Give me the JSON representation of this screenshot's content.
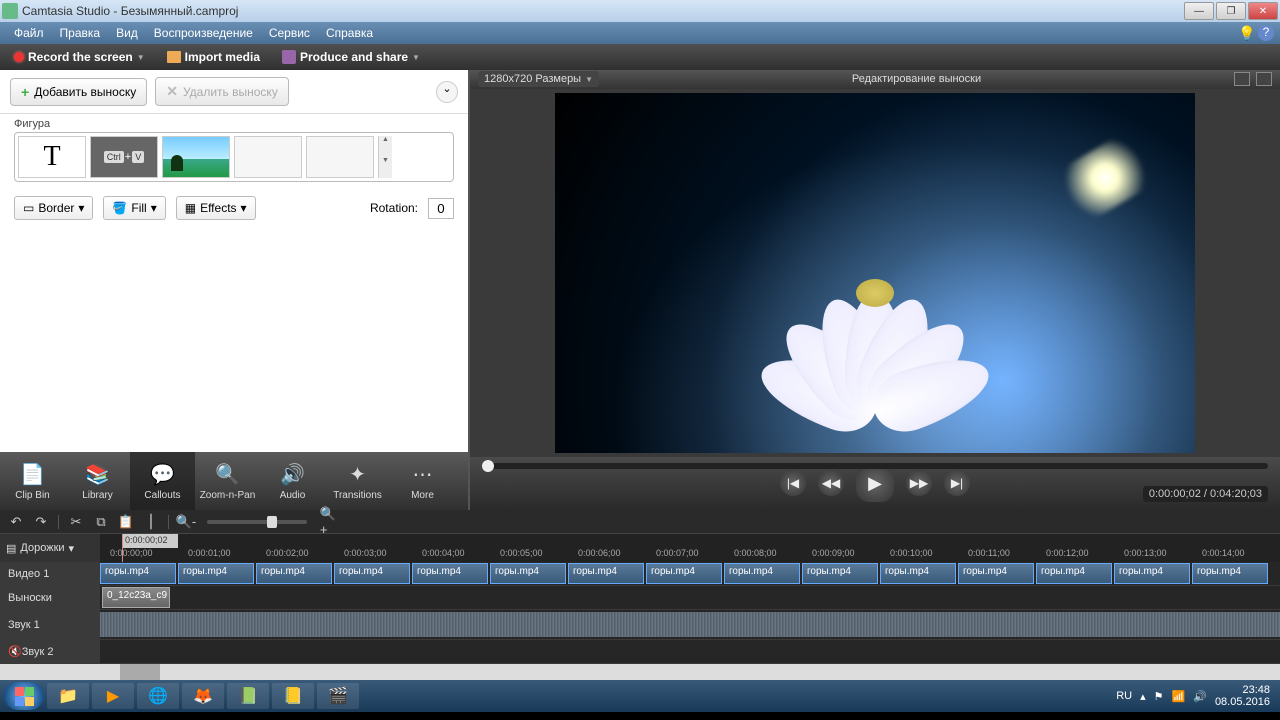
{
  "titlebar": {
    "title": "Camtasia Studio - Безымянный.camproj"
  },
  "menubar": {
    "items": [
      "Файл",
      "Правка",
      "Вид",
      "Воспроизведение",
      "Сервис",
      "Справка"
    ]
  },
  "maintoolbar": {
    "record": "Record the screen",
    "import": "Import media",
    "produce": "Produce and share"
  },
  "preview": {
    "dimensions": "1280x720   Размеры",
    "title": "Редактирование выноски",
    "time": "0:00:00;02 / 0:04:20;03"
  },
  "callouts": {
    "add": "Добавить выноску",
    "remove": "Удалить выноску",
    "shape_label": "Фигура",
    "border": "Border",
    "fill": "Fill",
    "effects": "Effects",
    "rotation_label": "Rotation:",
    "rotation_value": "0"
  },
  "tabs": {
    "clipbin": "Clip Bin",
    "library": "Library",
    "callouts": "Callouts",
    "zoom": "Zoom-n-Pan",
    "audio": "Audio",
    "transitions": "Transitions",
    "more": "More"
  },
  "timeline": {
    "tracks_label": "Дорожки",
    "playhead": "0:00:00;02",
    "ticks": [
      "0:00:00;00",
      "0:00:01;00",
      "0:00:02;00",
      "0:00:03;00",
      "0:00:04;00",
      "0:00:05;00",
      "0:00:06;00",
      "0:00:07;00",
      "0:00:08;00",
      "0:00:09;00",
      "0:00:10;00",
      "0:00:11;00",
      "0:00:12;00",
      "0:00:13;00",
      "0:00:14;00"
    ],
    "video_track": "Видео 1",
    "callout_track": "Выноски",
    "audio_track": "Звук 1",
    "audio_track2": "Звук 2",
    "clip_name": "горы.mp4",
    "callout_clip": "0_12c23a_c9"
  },
  "systray": {
    "lang": "RU",
    "time": "23:48",
    "date": "08.05.2016"
  }
}
